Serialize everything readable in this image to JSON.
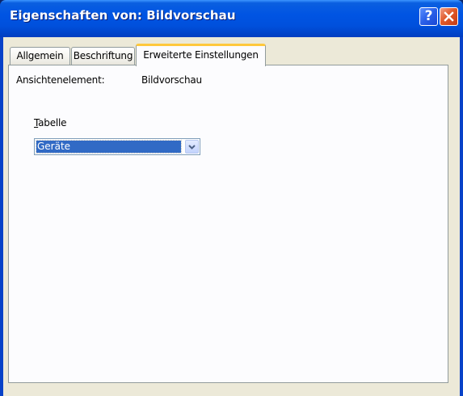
{
  "window": {
    "title": "Eigenschaften von: Bildvorschau",
    "help_button": "?",
    "close_button": "✕"
  },
  "tabs": [
    {
      "label": "Allgemein",
      "active": false
    },
    {
      "label": "Beschriftung",
      "active": false
    },
    {
      "label": "Erweiterte Einstellungen",
      "active": true
    }
  ],
  "panel": {
    "view_element_label": "Ansichtenelement:",
    "view_element_value": "Bildvorschau",
    "table_label": "Tabelle",
    "table_value": "Geräte"
  },
  "colors": {
    "titlebar": "#0054e3",
    "selection": "#316ac5",
    "active_tab_accent": "#ffc83c",
    "dialog_background": "#ece9d8"
  },
  "icons": {
    "help": "help-icon",
    "close": "close-icon",
    "dropdown": "chevron-down-icon"
  }
}
